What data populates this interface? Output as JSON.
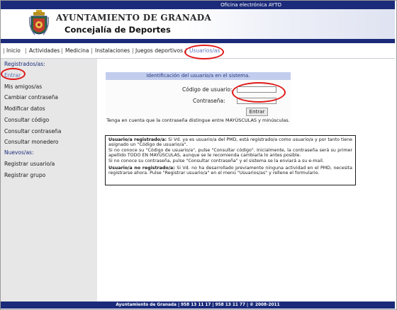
{
  "topbar": {
    "title": "Oficina electrónica AYTO"
  },
  "header": {
    "org_name": "AYUNTAMIENTO DE GRANADA",
    "dept_name": "Concejalía de Deportes"
  },
  "nav": {
    "items": [
      "Inicio",
      "Actividades",
      "Medicina",
      "Instalaciones",
      "Juegos deportivos",
      "Usuarios/as"
    ],
    "active": "Usuarios/as"
  },
  "sidebar": {
    "registered_heading": "Registrados/as:",
    "registered_items": [
      "Entrar",
      "Mis amigos/as",
      "Cambiar contraseña",
      "Modificar datos",
      "Consultar código",
      "Consultar contraseña",
      "Consultar monedero"
    ],
    "new_heading": "Nuevos/as:",
    "new_items": [
      "Registrar usuario/a",
      "Registrar grupo"
    ]
  },
  "login": {
    "title": "Identificación del usuario/a en el sistema.",
    "user_code_label": "Código de usuario:",
    "user_code_value": "",
    "password_label": "Contraseña:",
    "password_value": "",
    "submit_label": "Entrar",
    "note": "Tenga en cuenta que la contraseña distingue entre MAYÚSCULAS y minúsculas."
  },
  "info": {
    "p1_bold": "Usuario/a registrado/a:",
    "p1_text1": " Si Vd. ya es usuario/a del PMD, está registrado/a como usuario/a y por tanto tiene asignado un \"Código de usuario/a\".",
    "p1_text2": "Si no conoce su \"Código de usuario/a\", pulse \"Consultar código\". Inicialmente, la contraseña será su primer apellido TODO EN MAYÚSCULAS, aunque se le recomienda cambiarla lo antes posible.",
    "p1_text3": "Si no conoce su contraseña, pulse \"Consultar contraseña\" y el sistema se la enviará a su e-mail.",
    "p2_bold": "Usuario/a no registrado/a:",
    "p2_text": " Si Vd. no ha desarrollado previamente ninguna actividad en el PMD, necesita registrarse ahora. Pulse \"Registrar usuario/a\" en el menú \"Usuarios/as\" y rellene el formulario."
  },
  "footer": {
    "text": "Ayuntamiento de Granada | 958 13 11 17 | 958 13 11 77 | © 2008-2011"
  },
  "colors": {
    "navy": "#1b2b7a",
    "link": "#5e76b8",
    "highlight": "#e01818",
    "panel_header": "#c2cdee",
    "sidebar_bg": "#e7e7e7"
  }
}
